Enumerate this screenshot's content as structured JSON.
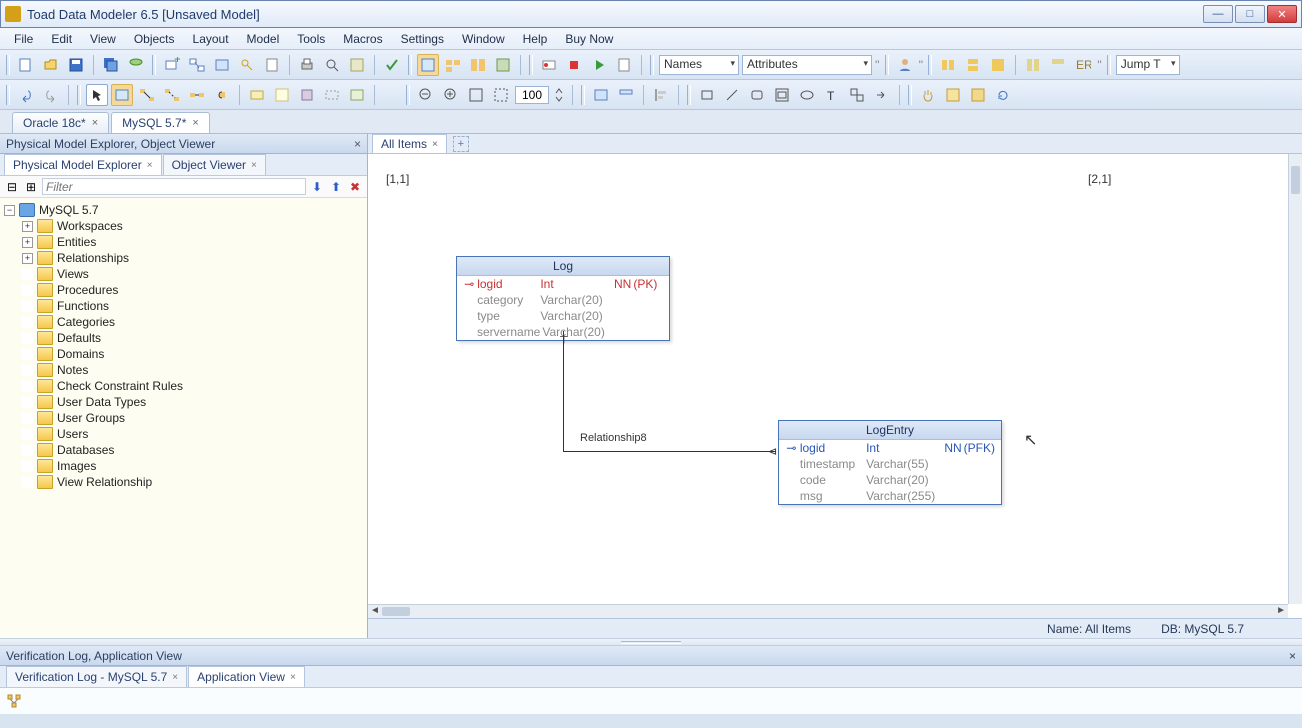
{
  "app_title": "Toad Data Modeler 6.5 [Unsaved Model]",
  "menu": [
    "File",
    "Edit",
    "View",
    "Objects",
    "Layout",
    "Model",
    "Tools",
    "Macros",
    "Settings",
    "Window",
    "Help",
    "Buy Now"
  ],
  "toolbar1": {
    "combo_names": "Names",
    "combo_attrs": "Attributes",
    "jump": "Jump T"
  },
  "toolbar2": {
    "zoom_value": "100"
  },
  "model_tabs": [
    {
      "label": "Oracle 18c*",
      "active": false
    },
    {
      "label": "MySQL 5.7*",
      "active": true
    }
  ],
  "left_panel": {
    "header": "Physical Model Explorer, Object Viewer",
    "tabs": [
      {
        "label": "Physical Model Explorer",
        "active": true
      },
      {
        "label": "Object Viewer",
        "active": false
      }
    ],
    "filter_placeholder": "Filter"
  },
  "tree": {
    "root": "MySQL 5.7",
    "children": [
      "Workspaces",
      "Entities",
      "Relationships",
      "Views",
      "Procedures",
      "Functions",
      "Categories",
      "Defaults",
      "Domains",
      "Notes",
      "Check Constraint Rules",
      "User Data Types",
      "User Groups",
      "Users",
      "Databases",
      "Images",
      "View Relationship"
    ],
    "expandable": [
      "Workspaces",
      "Entities",
      "Relationships"
    ]
  },
  "canvas_tabs": [
    {
      "label": "All Items",
      "active": true
    }
  ],
  "coords": {
    "left": "[1,1]",
    "right": "[2,1]"
  },
  "entities": {
    "log": {
      "title": "Log",
      "rows": [
        {
          "name": "logid",
          "type": "Int",
          "nn": "NN",
          "key": "(PK)",
          "kind": "key"
        },
        {
          "name": "category",
          "type": "Varchar(20)",
          "nn": "",
          "key": "",
          "kind": "attr"
        },
        {
          "name": "type",
          "type": "Varchar(20)",
          "nn": "",
          "key": "",
          "kind": "attr"
        },
        {
          "name": "servername",
          "type": "Varchar(20)",
          "nn": "",
          "key": "",
          "kind": "attr"
        }
      ]
    },
    "logentry": {
      "title": "LogEntry",
      "rows": [
        {
          "name": "logid",
          "type": "Int",
          "nn": "NN",
          "key": "(PFK)",
          "kind": "fk"
        },
        {
          "name": "timestamp",
          "type": "Varchar(55)",
          "nn": "",
          "key": "",
          "kind": "attr"
        },
        {
          "name": "code",
          "type": "Varchar(20)",
          "nn": "",
          "key": "",
          "kind": "attr"
        },
        {
          "name": "msg",
          "type": "Varchar(255)",
          "nn": "",
          "key": "",
          "kind": "attr"
        }
      ]
    },
    "relationship_label": "Relationship8"
  },
  "status": {
    "name_label": "Name:",
    "name_value": "All Items",
    "db_label": "DB:",
    "db_value": "MySQL 5.7"
  },
  "bottom": {
    "header": "Verification Log, Application View",
    "tabs": [
      {
        "label": "Verification Log - MySQL 5.7",
        "active": false
      },
      {
        "label": "Application View",
        "active": true
      }
    ]
  }
}
